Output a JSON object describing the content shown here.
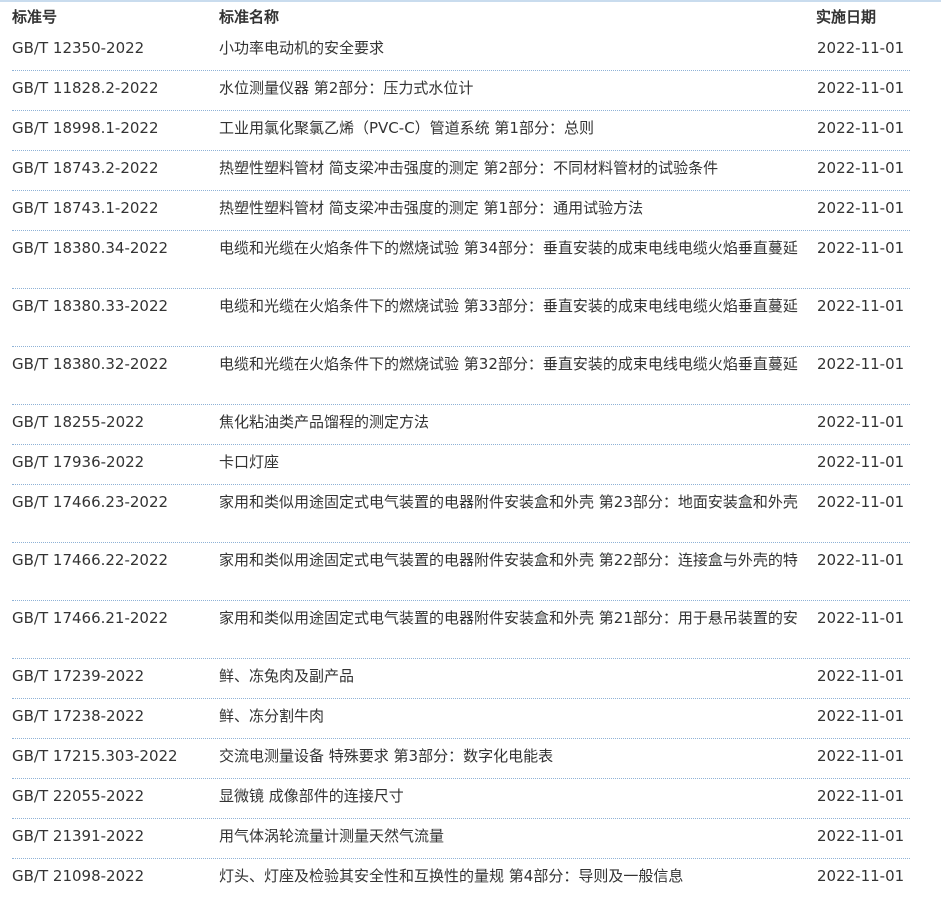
{
  "headers": {
    "code": "标准号",
    "name": "标准名称",
    "date": "实施日期"
  },
  "rows": [
    {
      "code": "GB/T 12350-2022",
      "name": "小功率电动机的安全要求",
      "date": "2022-11-01"
    },
    {
      "code": "GB/T 11828.2-2022",
      "name": "水位测量仪器 第2部分：压力式水位计",
      "date": "2022-11-01"
    },
    {
      "code": "GB/T 18998.1-2022",
      "name": "工业用氯化聚氯乙烯（PVC-C）管道系统 第1部分：总则",
      "date": "2022-11-01"
    },
    {
      "code": "GB/T 18743.2-2022",
      "name": "热塑性塑料管材 简支梁冲击强度的测定 第2部分：不同材料管材的试验条件",
      "date": "2022-11-01"
    },
    {
      "code": "GB/T 18743.1-2022",
      "name": "热塑性塑料管材 简支梁冲击强度的测定 第1部分：通用试验方法",
      "date": "2022-11-01"
    },
    {
      "code": "GB/T 18380.34-2022",
      "name": "电缆和光缆在火焰条件下的燃烧试验 第34部分：垂直安装的成束电线电缆火焰垂直蔓延",
      "date": "2022-11-01"
    },
    {
      "code": "GB/T 18380.33-2022",
      "name": "电缆和光缆在火焰条件下的燃烧试验 第33部分：垂直安装的成束电线电缆火焰垂直蔓延",
      "date": "2022-11-01"
    },
    {
      "code": "GB/T 18380.32-2022",
      "name": "电缆和光缆在火焰条件下的燃烧试验 第32部分：垂直安装的成束电线电缆火焰垂直蔓延",
      "date": "2022-11-01"
    },
    {
      "code": "GB/T 18255-2022",
      "name": "焦化粘油类产品馏程的测定方法",
      "date": "2022-11-01"
    },
    {
      "code": "GB/T 17936-2022",
      "name": "卡口灯座",
      "date": "2022-11-01"
    },
    {
      "code": "GB/T 17466.23-2022",
      "name": "家用和类似用途固定式电气装置的电器附件安装盒和外壳 第23部分：地面安装盒和外壳",
      "date": "2022-11-01"
    },
    {
      "code": "GB/T 17466.22-2022",
      "name": "家用和类似用途固定式电气装置的电器附件安装盒和外壳 第22部分：连接盒与外壳的特",
      "date": "2022-11-01"
    },
    {
      "code": "GB/T 17466.21-2022",
      "name": "家用和类似用途固定式电气装置的电器附件安装盒和外壳 第21部分：用于悬吊装置的安",
      "date": "2022-11-01"
    },
    {
      "code": "GB/T 17239-2022",
      "name": "鲜、冻兔肉及副产品",
      "date": "2022-11-01"
    },
    {
      "code": "GB/T 17238-2022",
      "name": "鲜、冻分割牛肉",
      "date": "2022-11-01"
    },
    {
      "code": "GB/T 17215.303-2022",
      "name": "交流电测量设备 特殊要求 第3部分：数字化电能表",
      "date": "2022-11-01"
    },
    {
      "code": "GB/T 22055-2022",
      "name": "显微镜 成像部件的连接尺寸",
      "date": "2022-11-01"
    },
    {
      "code": "GB/T 21391-2022",
      "name": "用气体涡轮流量计测量天然气流量",
      "date": "2022-11-01"
    },
    {
      "code": "GB/T 21098-2022",
      "name": "灯头、灯座及检验其安全性和互换性的量规 第4部分：导则及一般信息",
      "date": "2022-11-01"
    }
  ]
}
